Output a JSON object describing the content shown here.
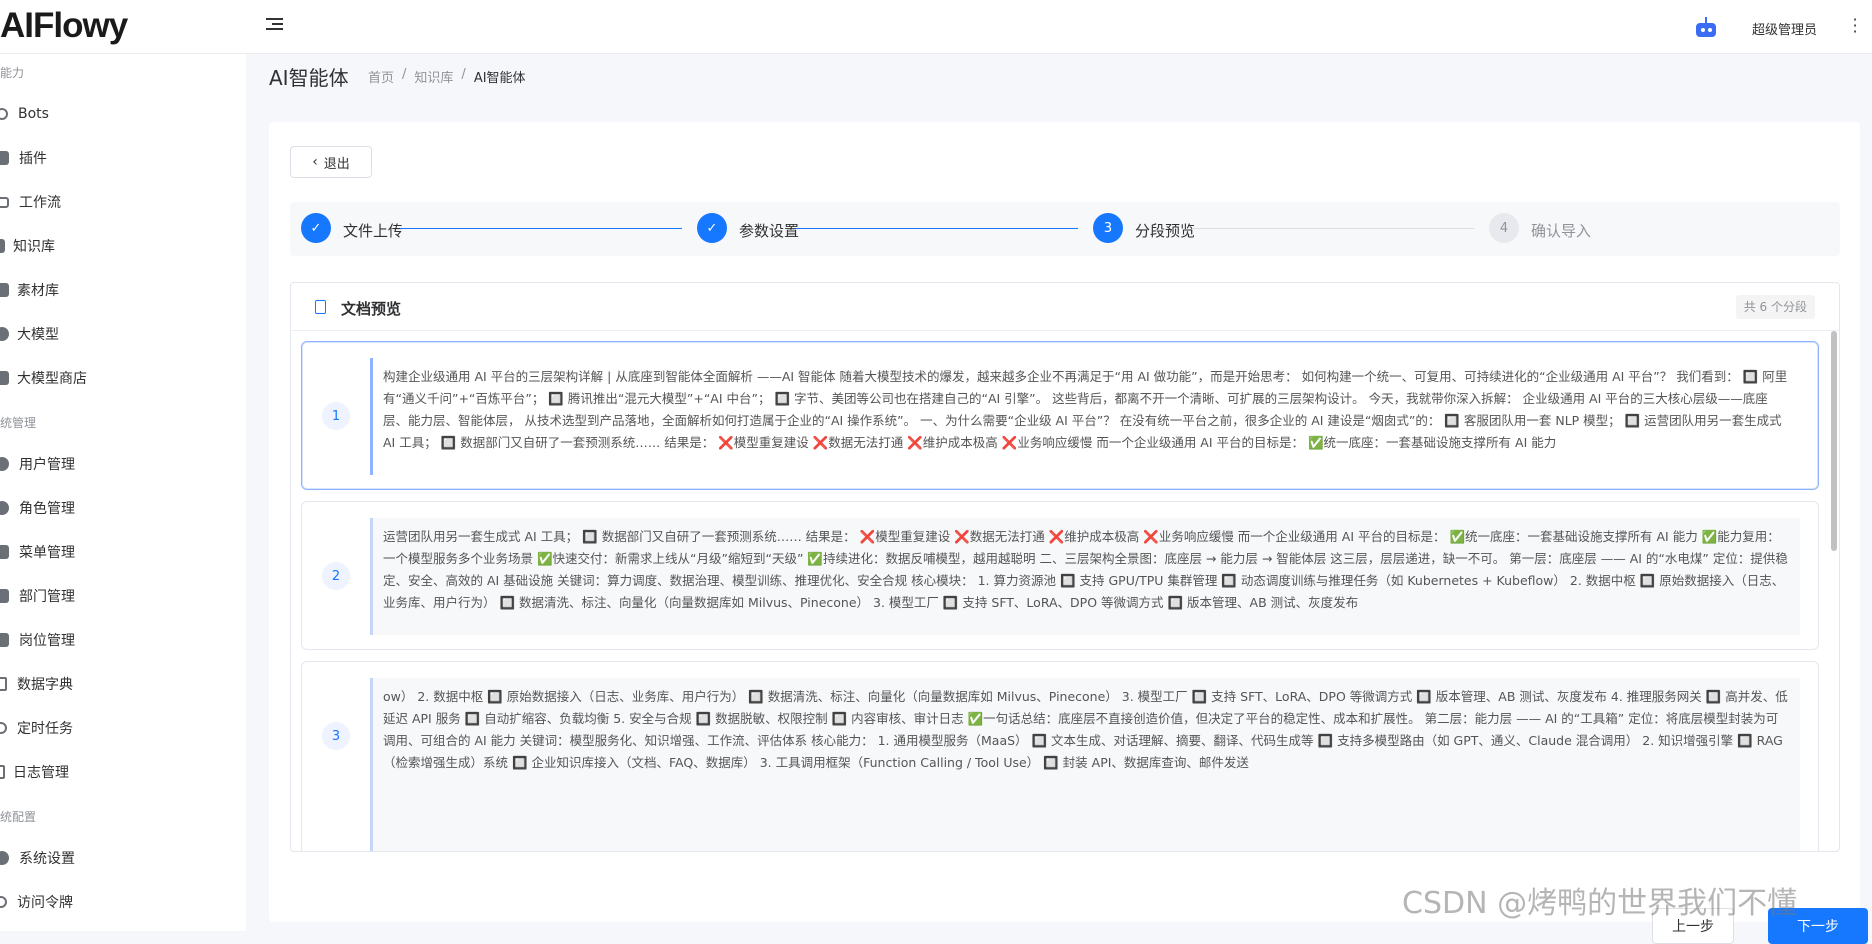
{
  "header": {
    "logo_text": "AIFlowy",
    "user_name": "超级管理员"
  },
  "sidebar": {
    "groups": [
      {
        "label": "能力"
      },
      {
        "label": "统管理"
      },
      {
        "label": "统配置"
      }
    ],
    "items": [
      {
        "label": "Bots"
      },
      {
        "label": "插件"
      },
      {
        "label": "工作流"
      },
      {
        "label": "知识库"
      },
      {
        "label": "素材库"
      },
      {
        "label": "大模型"
      },
      {
        "label": "大模型商店"
      },
      {
        "label": "用户管理"
      },
      {
        "label": "角色管理"
      },
      {
        "label": "菜单管理"
      },
      {
        "label": "部门管理"
      },
      {
        "label": "岗位管理"
      },
      {
        "label": "数据字典"
      },
      {
        "label": "定时任务"
      },
      {
        "label": "日志管理"
      },
      {
        "label": "系统设置"
      },
      {
        "label": "访问令牌"
      }
    ]
  },
  "page": {
    "title": "AI智能体",
    "breadcrumb": [
      "首页",
      "知识库",
      "AI智能体"
    ],
    "breadcrumb_sep": "/",
    "exit_label": "退出"
  },
  "steps": [
    {
      "index": "1",
      "label": "文件上传",
      "state": "done"
    },
    {
      "index": "2",
      "label": "参数设置",
      "state": "done"
    },
    {
      "index": "3",
      "label": "分段预览",
      "state": "active"
    },
    {
      "index": "4",
      "label": "确认导入",
      "state": "wait"
    }
  ],
  "preview": {
    "title": "文档预览",
    "count_label": "共 6 个分段",
    "segments": [
      {
        "num": "1",
        "text": "构建企业级通用 AI 平台的三层架构详解 | 从底座到智能体全面解析 ——AI 智能体 随着大模型技术的爆发，越来越多企业不再满足于“用 AI 做功能”，而是开始思考： 如何构建一个统一、可复用、可持续进化的“企业级通用 AI 平台”？ 我们看到： 🔲 阿里有“通义千问”+“百炼平台”； 🔲 腾讯推出“混元大模型”+“AI 中台”； 🔲 字节、美团等公司也在搭建自己的“AI 引擎”。 这些背后，都离不开一个清晰、可扩展的三层架构设计。 今天，我就带你深入拆解： 企业级通用 AI 平台的三大核心层级——底座层、能力层、智能体层， 从技术选型到产品落地，全面解析如何打造属于企业的“AI 操作系统”。 一、为什么需要“企业级 AI 平台”？ 在没有统一平台之前，很多企业的 AI 建设是“烟囱式”的： 🔲 客服团队用一套 NLP 模型； 🔲 运营团队用另一套生成式 AI 工具； 🔲 数据部门又自研了一套预测系统…… 结果是： ❌模型重复建设 ❌数据无法打通 ❌维护成本极高 ❌业务响应缓慢 而一个企业级通用 AI 平台的目标是： ✅统一底座：一套基础设施支撑所有 AI 能力"
      },
      {
        "num": "2",
        "text": "运营团队用另一套生成式 AI 工具； 🔲 数据部门又自研了一套预测系统…… 结果是： ❌模型重复建设 ❌数据无法打通 ❌维护成本极高 ❌业务响应缓慢 而一个企业级通用 AI 平台的目标是： ✅统一底座：一套基础设施支撑所有 AI 能力 ✅能力复用：一个模型服务多个业务场景 ✅快速交付：新需求上线从“月级”缩短到“天级” ✅持续进化：数据反哺模型，越用越聪明 二、三层架构全景图：底座层 → 能力层 → 智能体层 这三层，层层递进，缺一不可。 第一层：底座层 —— AI 的“水电煤” 定位：提供稳定、安全、高效的 AI 基础设施 关键词：算力调度、数据治理、模型训练、推理优化、安全合规 核心模块： 1. 算力资源池 🔲 支持 GPU/TPU 集群管理 🔲 动态调度训练与推理任务（如 Kubernetes + Kubeflow） 2. 数据中枢 🔲 原始数据接入（日志、业务库、用户行为） 🔲 数据清洗、标注、向量化（向量数据库如 Milvus、Pinecone） 3. 模型工厂 🔲 支持 SFT、LoRA、DPO 等微调方式 🔲 版本管理、AB 测试、灰度发布"
      },
      {
        "num": "3",
        "text": "ow） 2. 数据中枢 🔲 原始数据接入（日志、业务库、用户行为） 🔲 数据清洗、标注、向量化（向量数据库如 Milvus、Pinecone） 3. 模型工厂 🔲 支持 SFT、LoRA、DPO 等微调方式 🔲 版本管理、AB 测试、灰度发布 4. 推理服务网关 🔲 高并发、低延迟 API 服务 🔲 自动扩缩容、负载均衡 5. 安全与合规 🔲 数据脱敏、权限控制 🔲 内容审核、审计日志 ✅一句话总结：底座层不直接创造价值，但决定了平台的稳定性、成本和扩展性。 第二层：能力层 —— AI 的“工具箱” 定位：将底层模型封装为可调用、可组合的 AI 能力 关键词：模型服务化、知识增强、工作流、评估体系 核心能力： 1. 通用模型服务（MaaS） 🔲 文本生成、对话理解、摘要、翻译、代码生成等 🔲 支持多模型路由（如 GPT、通义、Claude 混合调用） 2. 知识增强引擎 🔲 RAG（检索增强生成）系统 🔲 企业知识库接入（文档、FAQ、数据库） 3. 工具调用框架（Function Calling / Tool Use） 🔲 封装 API、数据库查询、邮件发送"
      }
    ]
  },
  "footer": {
    "prev_label": "上一步",
    "next_label": "下一步"
  },
  "watermark": "CSDN @烤鸭的世界我们不懂"
}
